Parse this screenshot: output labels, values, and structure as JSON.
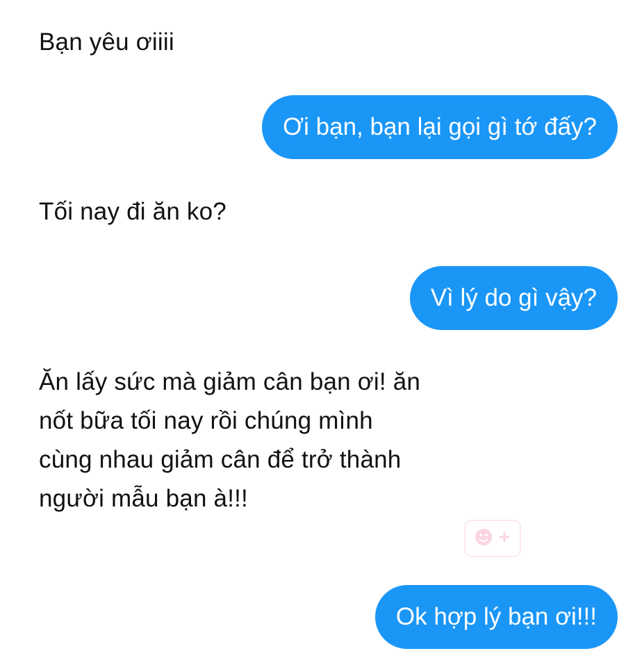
{
  "messages": [
    {
      "side": "received",
      "text": "Bạn yêu ơiiii"
    },
    {
      "side": "sent",
      "text": "Ơi bạn, bạn lại gọi gì tớ đấy?"
    },
    {
      "side": "received",
      "text": "Tối nay đi ăn ko?"
    },
    {
      "side": "sent",
      "text": "Vì lý do gì vậy?"
    },
    {
      "side": "received",
      "lines": [
        "Ăn lấy sức mà giảm cân bạn ơi! ăn",
        "nốt bữa tối nay rồi chúng mình",
        "cùng nhau giảm cân để trở thành",
        "người mẫu bạn à!!!"
      ]
    },
    {
      "side": "sent",
      "text": "Ok hợp lý bạn ơi!!!"
    }
  ],
  "icons": {
    "reaction": "add-reaction-icon"
  },
  "colors": {
    "sent_bubble": "#1a96f7",
    "sent_text": "#ffffff",
    "received_text": "#111111",
    "background": "#ffffff",
    "reaction_icon": "#f28aa6"
  }
}
